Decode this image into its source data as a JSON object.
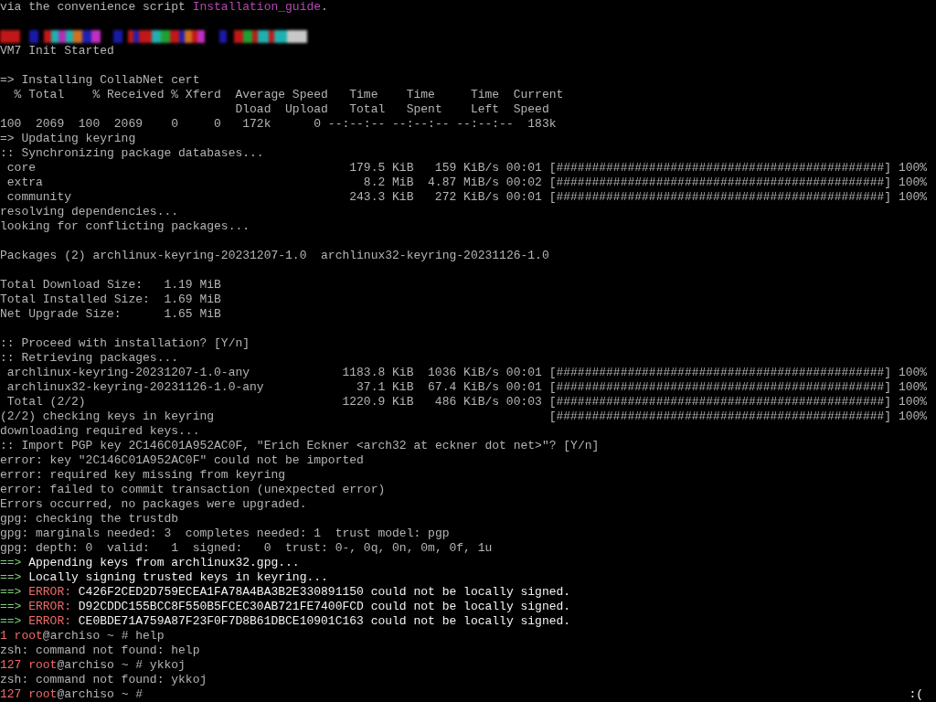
{
  "terminal": {
    "lines": [
      {
        "kind": "text",
        "segments": [
          {
            "t": "via the convenience script ",
            "kind": "plain"
          },
          {
            "t": "Installation_guide",
            "kind": "link"
          },
          {
            "t": ".",
            "kind": "plain"
          }
        ]
      },
      {
        "kind": "blank"
      },
      {
        "kind": "banner"
      },
      {
        "kind": "text",
        "segments": [
          {
            "t": "VM7 Init Started",
            "kind": "plain"
          }
        ]
      },
      {
        "kind": "blank"
      },
      {
        "kind": "text",
        "segments": [
          {
            "t": "=> Installing CollabNet cert",
            "kind": "plain"
          }
        ]
      },
      {
        "kind": "text",
        "segments": [
          {
            "t": "  % Total    % Received % Xferd  Average Speed   Time    Time     Time  Current",
            "kind": "plain"
          }
        ]
      },
      {
        "kind": "text",
        "segments": [
          {
            "t": "                                 Dload  Upload   Total   Spent    Left  Speed",
            "kind": "plain"
          }
        ]
      },
      {
        "kind": "text",
        "segments": [
          {
            "t": "100  2069  100  2069    0     0   172k      0 --:--:-- --:--:-- --:--:--  183k",
            "kind": "plain"
          }
        ]
      },
      {
        "kind": "text",
        "segments": [
          {
            "t": "=> Updating keyring",
            "kind": "plain"
          }
        ]
      },
      {
        "kind": "text",
        "segments": [
          {
            "t": ":: Synchronizing package databases...",
            "kind": "plain"
          }
        ]
      },
      {
        "kind": "progress",
        "name": "core",
        "size": "179.5 KiB",
        "speed": "159 KiB/s",
        "time": "00:01",
        "bar": "[##############################################]",
        "percent": "100%"
      },
      {
        "kind": "progress",
        "name": "extra",
        "size": "8.2 MiB",
        "speed": "4.87 MiB/s",
        "time": "00:02",
        "bar": "[##############################################]",
        "percent": "100%"
      },
      {
        "kind": "progress",
        "name": "community",
        "size": "243.3 KiB",
        "speed": "272 KiB/s",
        "time": "00:01",
        "bar": "[##############################################]",
        "percent": "100%"
      },
      {
        "kind": "text",
        "segments": [
          {
            "t": "resolving dependencies...",
            "kind": "plain"
          }
        ]
      },
      {
        "kind": "text",
        "segments": [
          {
            "t": "looking for conflicting packages...",
            "kind": "plain"
          }
        ]
      },
      {
        "kind": "blank"
      },
      {
        "kind": "text",
        "segments": [
          {
            "t": "Packages (2) archlinux-keyring-20231207-1.0  archlinux32-keyring-20231126-1.0",
            "kind": "plain"
          }
        ]
      },
      {
        "kind": "blank"
      },
      {
        "kind": "text",
        "segments": [
          {
            "t": "Total Download Size:   1.19 MiB",
            "kind": "plain"
          }
        ]
      },
      {
        "kind": "text",
        "segments": [
          {
            "t": "Total Installed Size:  1.69 MiB",
            "kind": "plain"
          }
        ]
      },
      {
        "kind": "text",
        "segments": [
          {
            "t": "Net Upgrade Size:      1.65 MiB",
            "kind": "plain"
          }
        ]
      },
      {
        "kind": "blank"
      },
      {
        "kind": "text",
        "segments": [
          {
            "t": ":: Proceed with installation? [Y/n]",
            "kind": "plain"
          }
        ]
      },
      {
        "kind": "text",
        "segments": [
          {
            "t": ":: Retrieving packages...",
            "kind": "plain"
          }
        ]
      },
      {
        "kind": "progress",
        "name": "archlinux-keyring-20231207-1.0-any",
        "size": "1183.8 KiB",
        "speed": "1036 KiB/s",
        "time": "00:01",
        "bar": "[##############################################]",
        "percent": "100%"
      },
      {
        "kind": "progress",
        "name": "archlinux32-keyring-20231126-1.0-any",
        "size": "37.1 KiB",
        "speed": "67.4 KiB/s",
        "time": "00:01",
        "bar": "[##############################################]",
        "percent": "100%"
      },
      {
        "kind": "progress",
        "name": "Total (2/2)",
        "size": "1220.9 KiB",
        "speed": "486 KiB/s",
        "time": "00:03",
        "bar": "[##############################################]",
        "percent": "100%"
      },
      {
        "kind": "progress",
        "name": "(2/2) checking keys in keyring",
        "bar": "[##############################################]",
        "percent": "100%"
      },
      {
        "kind": "text",
        "segments": [
          {
            "t": "downloading required keys...",
            "kind": "plain"
          }
        ]
      },
      {
        "kind": "text",
        "segments": [
          {
            "t": ":: Import PGP key 2C146C01A952AC0F, \"Erich Eckner <arch32 at eckner dot net>\"? [Y/n]",
            "kind": "plain"
          }
        ]
      },
      {
        "kind": "text",
        "segments": [
          {
            "t": "error: key \"2C146C01A952AC0F\" could not be imported",
            "kind": "plain"
          }
        ]
      },
      {
        "kind": "text",
        "segments": [
          {
            "t": "error: required key missing from keyring",
            "kind": "plain"
          }
        ]
      },
      {
        "kind": "text",
        "segments": [
          {
            "t": "error: failed to commit transaction (unexpected error)",
            "kind": "plain"
          }
        ]
      },
      {
        "kind": "text",
        "segments": [
          {
            "t": "Errors occurred, no packages were upgraded.",
            "kind": "plain"
          }
        ]
      },
      {
        "kind": "text",
        "segments": [
          {
            "t": "gpg: checking the trustdb",
            "kind": "plain"
          }
        ]
      },
      {
        "kind": "text",
        "segments": [
          {
            "t": "gpg: marginals needed: 3  completes needed: 1  trust model: pgp",
            "kind": "plain"
          }
        ]
      },
      {
        "kind": "text",
        "segments": [
          {
            "t": "gpg: depth: 0  valid:   1  signed:   0  trust: 0-, 0q, 0n, 0m, 0f, 1u",
            "kind": "plain"
          }
        ]
      },
      {
        "kind": "text",
        "segments": [
          {
            "t": "==>",
            "kind": "arrow"
          },
          {
            "t": " Appending keys from archlinux32.gpg...",
            "kind": "bold"
          }
        ]
      },
      {
        "kind": "text",
        "segments": [
          {
            "t": "==>",
            "kind": "arrow"
          },
          {
            "t": " Locally signing trusted keys in keyring...",
            "kind": "bold"
          }
        ]
      },
      {
        "kind": "text",
        "segments": [
          {
            "t": "==>",
            "kind": "arrow"
          },
          {
            "t": " ERROR:",
            "kind": "error"
          },
          {
            "t": " C426F2CED2D759ECEA1FA78A4BA3B2E330891150 could not be locally signed.",
            "kind": "bold"
          }
        ]
      },
      {
        "kind": "text",
        "segments": [
          {
            "t": "==>",
            "kind": "arrow"
          },
          {
            "t": " ERROR:",
            "kind": "error"
          },
          {
            "t": " D92CDDC155BCC8F550B5FCEC30AB721FE7400FCD could not be locally signed.",
            "kind": "bold"
          }
        ]
      },
      {
        "kind": "text",
        "segments": [
          {
            "t": "==>",
            "kind": "arrow"
          },
          {
            "t": " ERROR:",
            "kind": "error"
          },
          {
            "t": " CE0BDE71A759A87F23F0F7D8B61DBCE10901C163 could not be locally signed.",
            "kind": "bold"
          }
        ]
      },
      {
        "kind": "text",
        "segments": [
          {
            "t": "1",
            "kind": "prompt"
          },
          {
            "t": " root",
            "kind": "prompt"
          },
          {
            "t": "@archiso ~ # help",
            "kind": "plain"
          }
        ]
      },
      {
        "kind": "text",
        "segments": [
          {
            "t": "zsh: command not found: help",
            "kind": "plain"
          }
        ]
      },
      {
        "kind": "text",
        "segments": [
          {
            "t": "127",
            "kind": "prompt"
          },
          {
            "t": " root",
            "kind": "prompt"
          },
          {
            "t": "@archiso ~ # ykkoj",
            "kind": "plain"
          }
        ]
      },
      {
        "kind": "text",
        "segments": [
          {
            "t": "zsh: command not found: ykkoj",
            "kind": "plain"
          }
        ]
      },
      {
        "kind": "text",
        "segments": [
          {
            "t": "127",
            "kind": "prompt"
          },
          {
            "t": " root",
            "kind": "prompt"
          },
          {
            "t": "@archiso ~ #",
            "kind": "plain"
          }
        ],
        "status": ":("
      }
    ]
  }
}
